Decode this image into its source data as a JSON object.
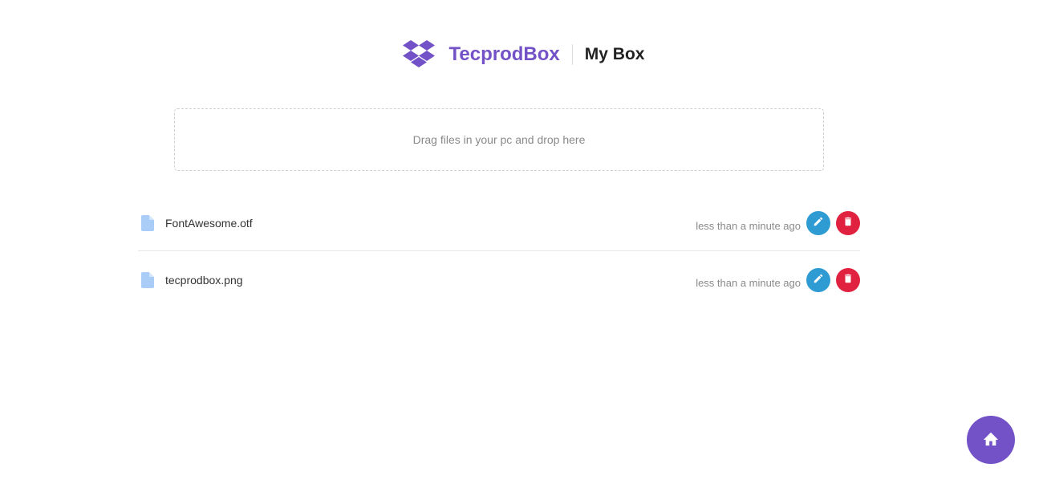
{
  "header": {
    "brand": "TecprodBox",
    "subtitle": "My Box",
    "logo_icon": "dropbox-icon",
    "brand_color": "#7352c7"
  },
  "dropzone": {
    "text": "Drag files in your pc and drop here"
  },
  "files": [
    {
      "name": "FontAwesome.otf",
      "time": "less than a minute ago"
    },
    {
      "name": "tecprodbox.png",
      "time": "less than a minute ago"
    }
  ],
  "colors": {
    "edit": "#2f9bd3",
    "delete": "#e0213f",
    "file_icon": "#a9cdf7",
    "fab": "#7352c7"
  },
  "fab": {
    "icon": "home-icon"
  }
}
